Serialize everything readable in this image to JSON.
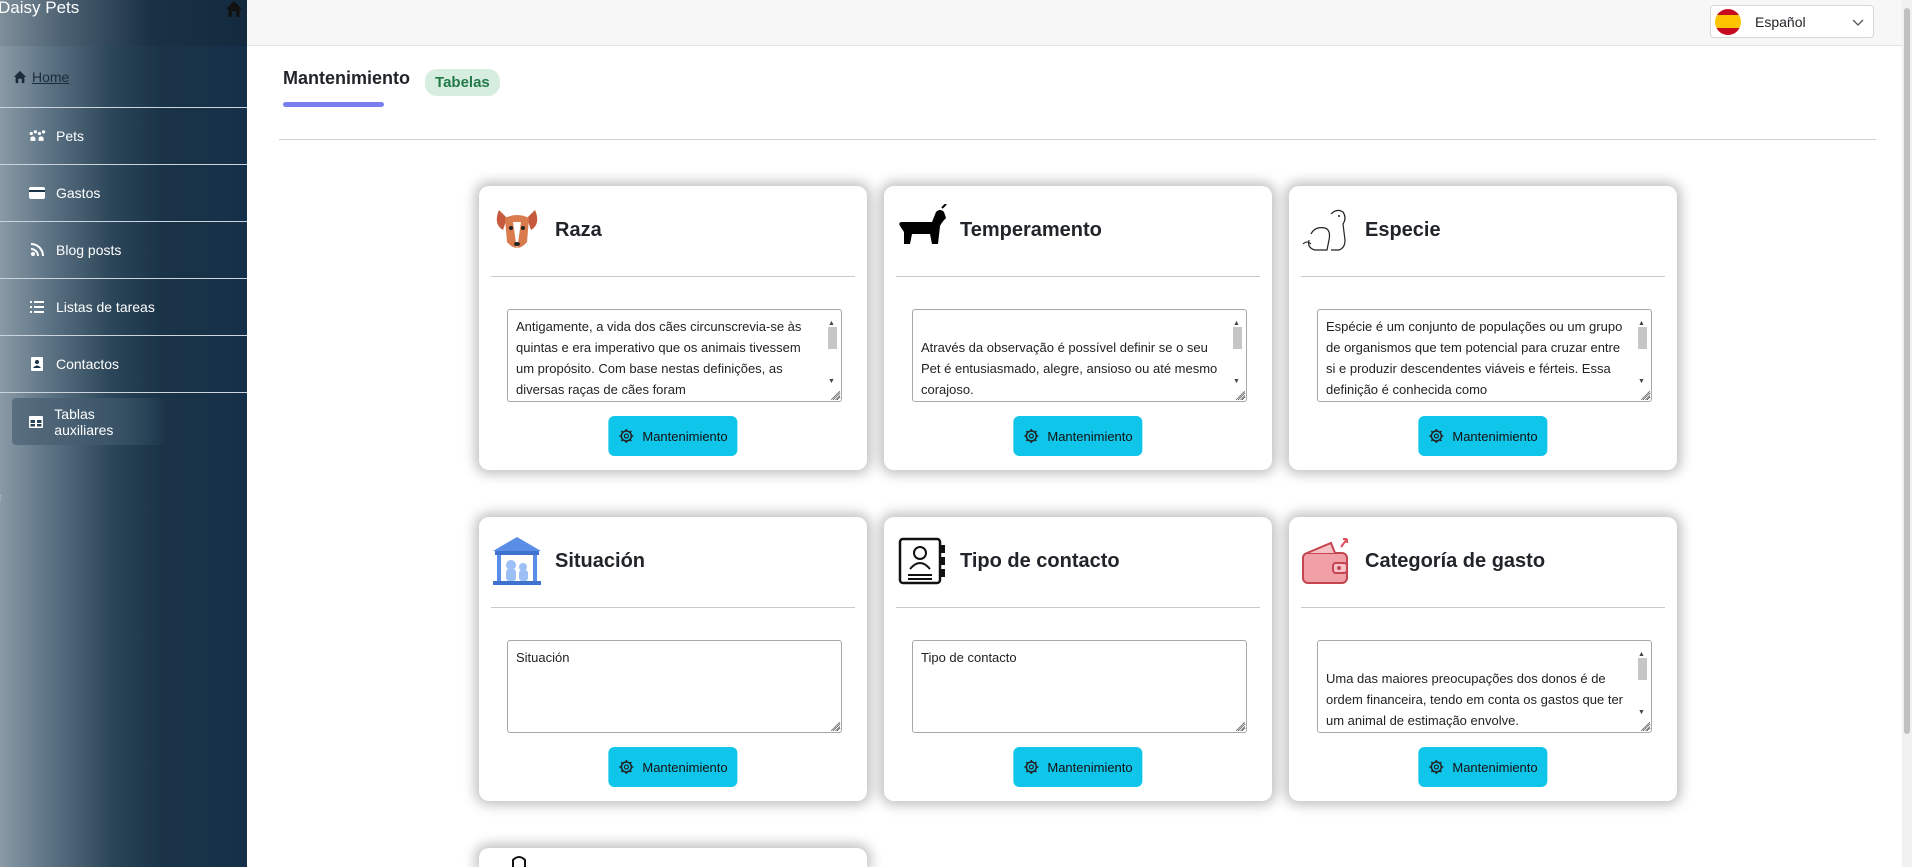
{
  "app": {
    "brand": "Daisy Pets"
  },
  "sidebar": {
    "home": "Home",
    "items": [
      {
        "label": "Pets",
        "icon": "paw-icon"
      },
      {
        "label": "Gastos",
        "icon": "card-icon"
      },
      {
        "label": "Blog posts",
        "icon": "rss-icon"
      },
      {
        "label": "Listas de tareas",
        "icon": "list-icon"
      },
      {
        "label": "Contactos",
        "icon": "contact-icon"
      },
      {
        "label": "Tablas auxiliares",
        "icon": "table-icon"
      }
    ]
  },
  "topbar": {
    "language": "Español"
  },
  "tabs": {
    "main": "Mantenimiento",
    "badge": "Tabelas"
  },
  "cards": [
    {
      "title": "Raza",
      "icon": "dog-face-icon",
      "text": "Antigamente, a vida dos cães circunscrevia-se às quintas e era imperativo que os animais tivessem um propósito. Com base nestas definições, as diversas raças de cães foram",
      "button": "Mantenimiento"
    },
    {
      "title": "Temperamento",
      "icon": "dog-silhouette-icon",
      "text": "Através da observação é possível definir se o seu Pet é entusiasmado, alegre, ansioso ou até mesmo corajoso.\nPor exemplo: cães de tutoras mulheres,",
      "button": "Mantenimiento"
    },
    {
      "title": "Especie",
      "icon": "pet-outline-icon",
      "text": "Espécie é um conjunto de populações ou um grupo de organismos que tem potencial para cruzar entre si e produzir descendentes viáveis e férteis. Essa definição é conhecida como",
      "button": "Mantenimiento"
    },
    {
      "title": "Situación",
      "icon": "pet-shelter-icon",
      "text": "Situación",
      "button": "Mantenimiento"
    },
    {
      "title": "Tipo de contacto",
      "icon": "contact-book-icon",
      "text": "Tipo de contacto",
      "button": "Mantenimiento"
    },
    {
      "title": "Categoría de gasto",
      "icon": "wallet-icon",
      "text": "Uma das maiores preocupações dos donos é de ordem financeira, tendo em conta os gastos que ter um animal de estimação envolve.\nDe acordo com as contas da Deco Proteste, um",
      "button": "Mantenimiento"
    }
  ],
  "colors": {
    "accent": "#10c5ea",
    "tab_underline": "#7a7ff0",
    "badge_bg": "#d6ede0",
    "badge_text": "#237a48"
  }
}
